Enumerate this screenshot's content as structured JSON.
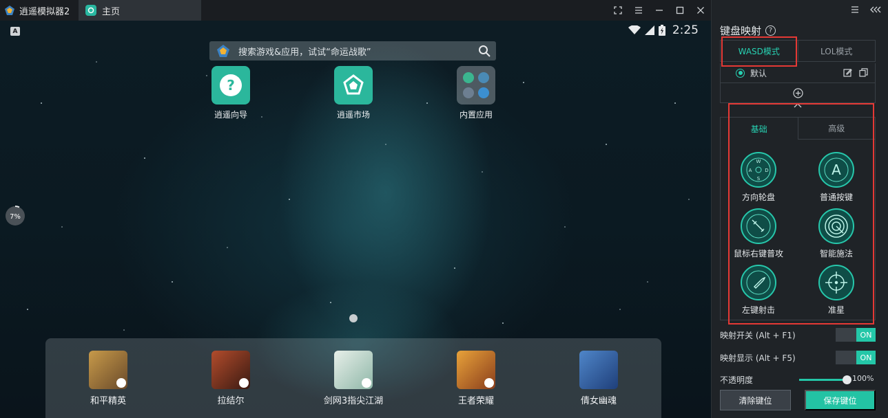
{
  "app": {
    "title": "逍遥模拟器2",
    "tab_home": "主页"
  },
  "status": {
    "badge": "A",
    "time": "2:25"
  },
  "search": {
    "placeholder": "搜索游戏&应用，试试“命运战歌”"
  },
  "desktop": {
    "icons": [
      {
        "label": "逍遥向导",
        "icon": "question-icon"
      },
      {
        "label": "逍遥市场",
        "icon": "market-icon"
      },
      {
        "label": "内置应用",
        "icon": "folder-icon"
      }
    ],
    "progress_percent": 7,
    "progress_label": "7%"
  },
  "dock": {
    "games": [
      {
        "label": "和平精英"
      },
      {
        "label": "拉结尔"
      },
      {
        "label": "剑网3指尖江湖"
      },
      {
        "label": "王者荣耀"
      },
      {
        "label": "倩女幽魂"
      }
    ]
  },
  "panel": {
    "title": "键盘映射",
    "mode_tabs": [
      "WASD模式",
      "LOL模式"
    ],
    "preset": "默认",
    "key_tabs": [
      "基础",
      "高级"
    ],
    "keys": [
      {
        "label": "方向轮盘",
        "icon": "dpad-icon"
      },
      {
        "label": "普通按键",
        "icon": "key-a-icon"
      },
      {
        "label": "鼠标右键普攻",
        "icon": "sword-icon"
      },
      {
        "label": "智能施法",
        "icon": "smart-cast-icon"
      },
      {
        "label": "左键射击",
        "icon": "bullet-icon"
      },
      {
        "label": "准星",
        "icon": "crosshair-icon"
      }
    ],
    "dpad_letters": [
      "W",
      "A",
      "S",
      "D"
    ],
    "key_a_letter": "A",
    "switch_map": "映射开关 (Alt + F1)",
    "switch_show": "映射显示 (Alt + F5)",
    "switch_on": "ON",
    "opacity_label": "不透明度",
    "opacity_value": "100%",
    "btn_clear": "清除键位",
    "btn_save": "保存键位"
  },
  "colors": {
    "accent": "#24c7a8",
    "highlight": "#e53935"
  }
}
